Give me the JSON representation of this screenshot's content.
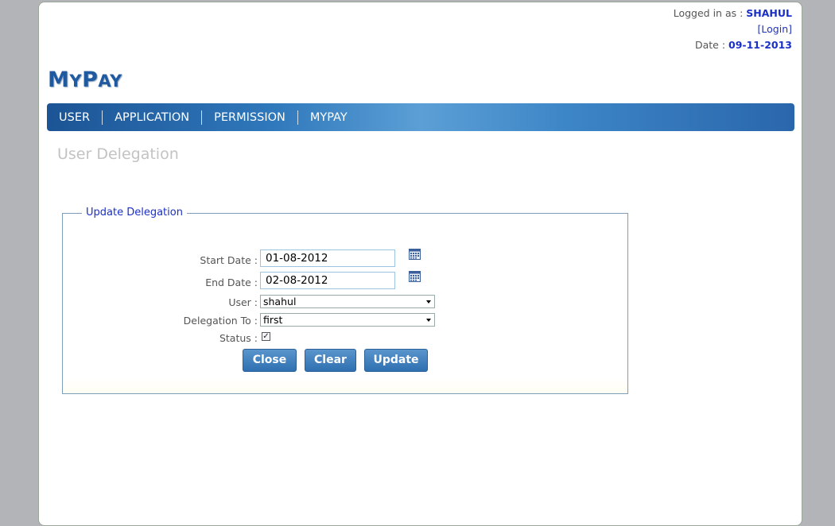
{
  "header": {
    "logged_in_label": "Logged in as : ",
    "username": "SHAHUL",
    "login_link": "[Login]",
    "date_label": "Date : ",
    "date_value": "09-11-2013"
  },
  "logo": {
    "text_big_m": "M",
    "text_small_y": "Y",
    "text_big_p": "P",
    "text_small_ay": "AY"
  },
  "nav": {
    "items": [
      "USER",
      "APPLICATION",
      "PERMISSION",
      "MYPAY"
    ]
  },
  "page_title": "User Delegation",
  "form": {
    "legend": "Update Delegation",
    "start_date_label": "Start Date :",
    "start_date_value": "01-08-2012",
    "end_date_label": "End Date :",
    "end_date_value": "02-08-2012",
    "user_label": "User :",
    "user_value": "shahul",
    "delegation_label": "Delegation To :",
    "delegation_value": "first",
    "status_label": "Status :",
    "status_checked": true,
    "buttons": {
      "close": "Close",
      "clear": "Clear",
      "update": "Update"
    }
  },
  "colors": {
    "nav_blue": "#2f78bb",
    "link_blue": "#1a2fc7",
    "background": "#b3b4b8"
  }
}
